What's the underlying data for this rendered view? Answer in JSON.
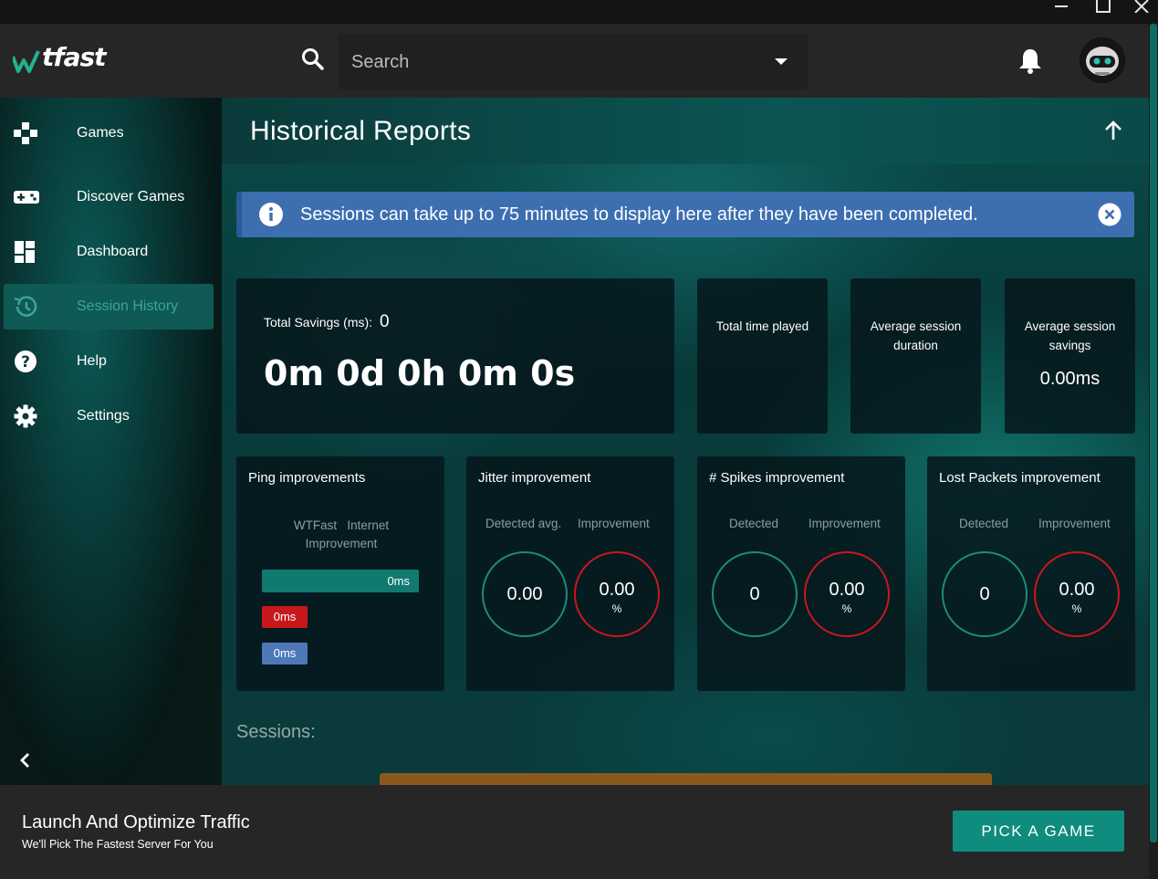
{
  "window": {
    "minimize_icon": "minimize-icon",
    "maximize_icon": "maximize-icon",
    "close_icon": "close-icon"
  },
  "header": {
    "logo_text": "tfast",
    "search": {
      "placeholder": "Search",
      "value": ""
    },
    "icons": [
      "search-icon",
      "chevron-down-icon",
      "bell-icon",
      "avatar"
    ]
  },
  "sidebar": {
    "items": [
      {
        "label": "Games",
        "icon": "gamepad-icon",
        "active": false
      },
      {
        "label": "Discover Games",
        "icon": "controller-icon",
        "active": false
      },
      {
        "label": "Dashboard",
        "icon": "dashboard-icon",
        "active": false
      },
      {
        "label": "Session History",
        "icon": "history-icon",
        "active": true
      },
      {
        "label": "Help",
        "icon": "help-icon",
        "active": false
      },
      {
        "label": "Settings",
        "icon": "gear-icon",
        "active": false
      }
    ]
  },
  "main": {
    "title": "Historical Reports",
    "alert": "Sessions can take up to 75 minutes to display here after they have been completed.",
    "savings": {
      "label": "Total Savings (ms):",
      "value": "0",
      "time": "0m 0d 0h 0m 0s"
    },
    "stats": [
      {
        "label": "Total time played",
        "value": ""
      },
      {
        "label": "Average session duration",
        "value": ""
      },
      {
        "label": "Average session savings",
        "value": "0.00ms"
      }
    ],
    "ping": {
      "title": "Ping improvements",
      "legend_line1": "WTFast   Internet",
      "legend_line2": "Improvement",
      "wtfast_value": "0ms",
      "internet_value": "0ms",
      "improvement_value": "0ms"
    },
    "jitter": {
      "title": "Jitter improvement",
      "col1": "Detected avg.",
      "col2": "Improvement",
      "detected": "0.00",
      "improvement": "0.00",
      "unit": "%"
    },
    "spikes": {
      "title": "# Spikes improvement",
      "col1": "Detected",
      "col2": "Improvement",
      "detected": "0",
      "improvement": "0.00",
      "unit": "%"
    },
    "packets": {
      "title": "Lost Packets improvement",
      "col1": "Detected",
      "col2": "Improvement",
      "detected": "0",
      "improvement": "0.00",
      "unit": "%"
    },
    "sessions_label": "Sessions:"
  },
  "footer": {
    "title": "Launch And Optimize Traffic",
    "subtitle": "We'll Pick The Fastest Server For You",
    "button": "PICK A GAME"
  },
  "colors": {
    "accent": "#0f8c7e",
    "alert": "#3d6fb0",
    "ring_teal": "#1e8a7c",
    "ring_red": "#c8181e",
    "bar_red": "#c8181e",
    "bar_blue": "#4f78b8"
  }
}
